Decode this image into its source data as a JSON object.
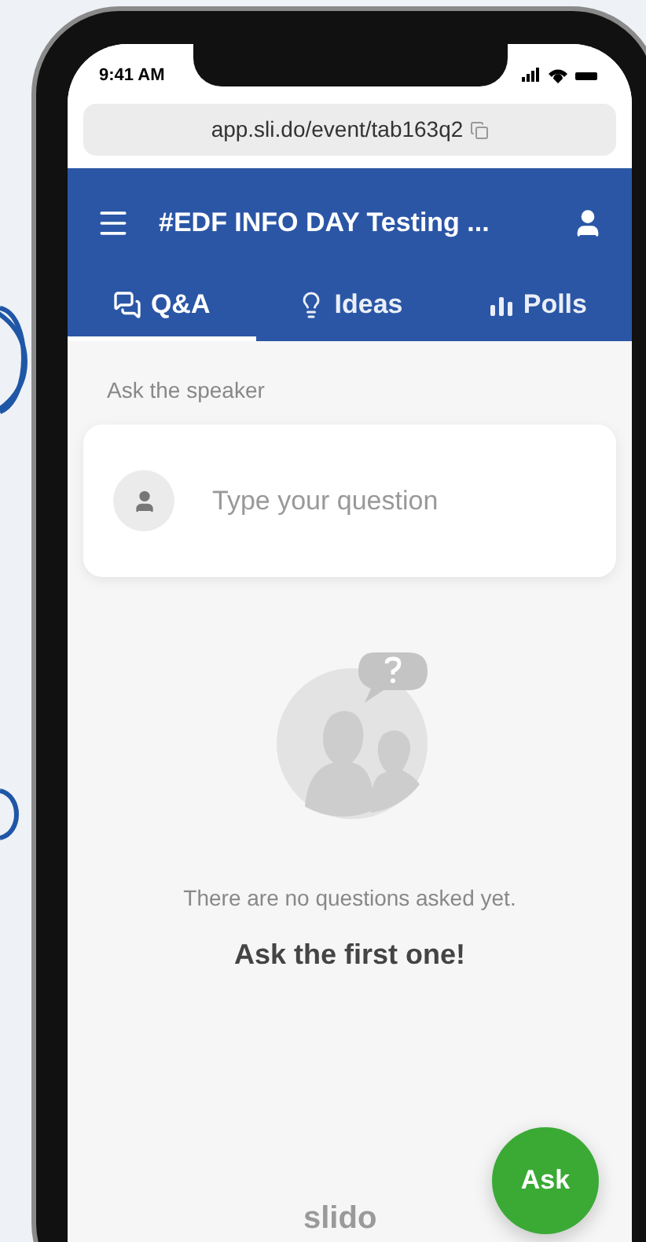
{
  "status_bar": {
    "time": "9:41 AM"
  },
  "url_bar": {
    "url": "app.sli.do/event/tab163q2"
  },
  "header": {
    "title": "#EDF INFO DAY Testing ..."
  },
  "tabs": [
    {
      "label": "Q&A",
      "kind": "chat",
      "selected": true
    },
    {
      "label": "Ideas",
      "kind": "bulb",
      "selected": false
    },
    {
      "label": "Polls",
      "kind": "bars",
      "selected": false
    }
  ],
  "section_label": "Ask the speaker",
  "question_field": {
    "placeholder": "Type your question"
  },
  "empty_state": {
    "message": "There are no questions asked yet.",
    "prompt": "Ask the first one!"
  },
  "brand": "slido",
  "ask_button": {
    "label": "Ask"
  }
}
